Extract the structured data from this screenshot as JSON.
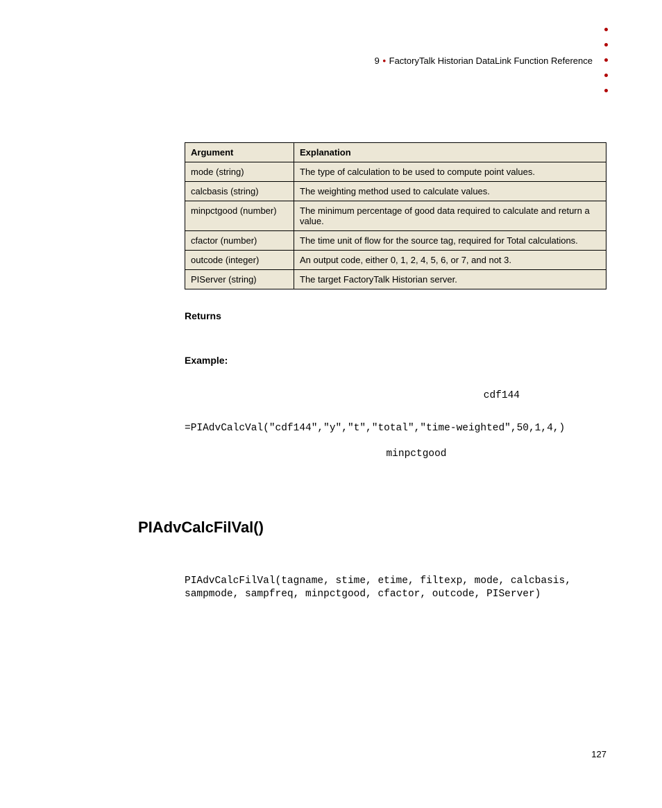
{
  "header": {
    "chapter_number": "9",
    "chapter_title": "FactoryTalk Historian DataLink Function Reference"
  },
  "table": {
    "headers": {
      "arg": "Argument",
      "exp": "Explanation"
    },
    "rows": [
      {
        "arg": "mode (string)",
        "exp": "The type of calculation to be used to compute point values."
      },
      {
        "arg": "calcbasis (string)",
        "exp": "The weighting method used to calculate values."
      },
      {
        "arg": "minpctgood (number)",
        "exp": "The minimum percentage of good data required to calculate and return a value."
      },
      {
        "arg": "cfactor (number)",
        "exp": "The time unit of flow for the source tag, required for Total calculations."
      },
      {
        "arg": "outcode (integer)",
        "exp": "An output code, either 0, 1, 2, 4, 5, 6, or 7, and not 3."
      },
      {
        "arg": "PIServer (string)",
        "exp": "The target FactoryTalk Historian server."
      }
    ]
  },
  "sections": {
    "returns_label": "Returns",
    "example_label": "Example:",
    "example_inline1": "cdf144",
    "example_code": "=PIAdvCalcVal(\"cdf144\",\"y\",\"t\",\"total\",\"time-weighted\",50,1,4,)",
    "example_inline2": "minpctgood"
  },
  "func": {
    "heading": "PIAdvCalcFilVal()",
    "signature": "PIAdvCalcFilVal(tagname, stime, etime, filtexp, mode, calcbasis, sampmode, sampfreq, minpctgood, cfactor, outcode, PIServer)"
  },
  "page_number": "127"
}
